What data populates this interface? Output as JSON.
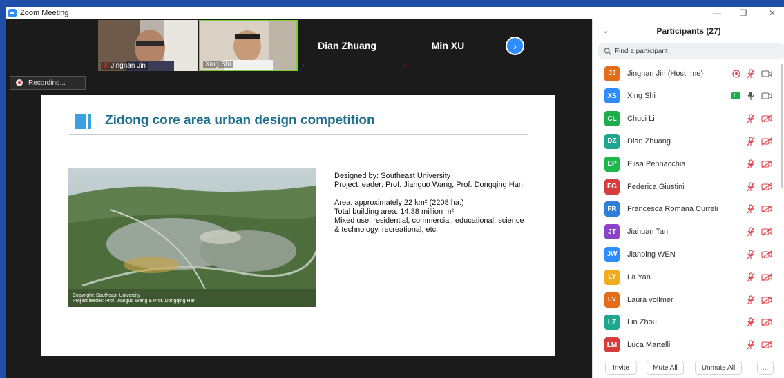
{
  "window": {
    "title": "Zoom Meeting",
    "minimize": "—",
    "restore": "❐",
    "close": "✕"
  },
  "video_strip": {
    "tiles": [
      {
        "name": "Jingnan Jin",
        "has_video": true
      },
      {
        "name": "Xing Shi",
        "has_video": true,
        "active_speaker": true
      },
      {
        "name": "Dian Zhuang",
        "has_video": false
      },
      {
        "name": "Min XU",
        "has_video": false
      }
    ],
    "next_icon": "chevron-right-icon"
  },
  "recording": {
    "label": "Recording..."
  },
  "slide": {
    "title": "Zidong core area urban design competition",
    "image_caption": [
      "Copyright: Southeast University",
      "Project leader: Prof. Jianguo Wang & Prof. Dongqing Han"
    ],
    "info": {
      "designed_by": "Designed by: Southeast University",
      "project_leader": "Project leader: Prof. Jianguo Wang, Prof. Dongqing Han",
      "area": "Area: approximately 22 km²  (2208 ha.)",
      "building_area": "Total building area: 14.38 million m²",
      "mixed_use_1": "Mixed use: residential, commercial, educational, science",
      "mixed_use_2": "& technology, recreational, etc."
    },
    "colors": {
      "title": "#1e6f8e",
      "accent": "#3aa0e0"
    }
  },
  "participants": {
    "title": "Participants (27)",
    "search_placeholder": "Find a participant",
    "list": [
      {
        "initials": "JJ",
        "name": "Jingnan Jin (Host, me)",
        "color": "#e46d1c",
        "recording": true,
        "mic": "muted",
        "video": "on"
      },
      {
        "initials": "XS",
        "name": "Xing Shi",
        "color": "#2d8cff",
        "sharing": true,
        "mic": "on",
        "video": "on"
      },
      {
        "initials": "CL",
        "name": "Chuci Li",
        "color": "#1cae4b",
        "mic": "muted",
        "video": "off"
      },
      {
        "initials": "DZ",
        "name": "Dian Zhuang",
        "color": "#1ea68f",
        "mic": "muted",
        "video": "off"
      },
      {
        "initials": "EP",
        "name": "Elisa Pennacchia",
        "color": "#1cb84a",
        "mic": "muted",
        "video": "off"
      },
      {
        "initials": "FG",
        "name": "Federica Giustini",
        "color": "#d63c3c",
        "mic": "muted",
        "video": "off"
      },
      {
        "initials": "FR",
        "name": "Francesca Romana Curreli",
        "color": "#2d7fd8",
        "mic": "muted",
        "video": "off"
      },
      {
        "initials": "JT",
        "name": "Jiahuan Tan",
        "color": "#8a43c9",
        "mic": "muted",
        "video": "off"
      },
      {
        "initials": "JW",
        "name": "Jianping WEN",
        "color": "#2d8cff",
        "mic": "muted",
        "video": "off"
      },
      {
        "initials": "LY",
        "name": "La Yan",
        "color": "#f2ab1c",
        "mic": "muted",
        "video": "off"
      },
      {
        "initials": "LV",
        "name": "Laura vollmer",
        "color": "#e46d1c",
        "mic": "muted",
        "video": "off"
      },
      {
        "initials": "LZ",
        "name": "Lin Zhou",
        "color": "#1ea68f",
        "mic": "muted",
        "video": "off"
      },
      {
        "initials": "LM",
        "name": "Luca Martelli",
        "color": "#d63c3c",
        "mic": "muted",
        "video": "off"
      }
    ],
    "footer": {
      "invite": "Invite",
      "mute_all": "Mute All",
      "unmute_all": "Unmute All",
      "more": "..."
    }
  }
}
